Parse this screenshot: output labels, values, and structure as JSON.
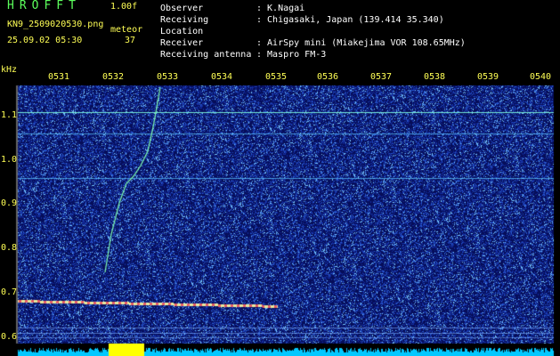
{
  "header": {
    "app_title": "HROFFT",
    "version": "1.00f",
    "filename": "KN9_2509020530.png",
    "mode": "meteor",
    "datetime": "25.09.02 05:30",
    "count": "37"
  },
  "info": [
    {
      "label": "Observer",
      "value": ": K.Nagai"
    },
    {
      "label": "Receiving Location",
      "value": ": Chigasaki, Japan (139.414 35.340)"
    },
    {
      "label": "Receiver",
      "value": ": AirSpy mini (Miakejima VOR 108.65MHz)"
    },
    {
      "label": "Receiving antenna",
      "value": ": Maspro FM-3"
    }
  ],
  "axis": {
    "freq_unit": "kHz",
    "time_ticks": [
      "0531",
      "0532",
      "0533",
      "0534",
      "0535",
      "0536",
      "0537",
      "0538",
      "0539",
      "0540"
    ],
    "freq_ticks": [
      "1.1",
      "1.0",
      "0.9",
      "0.8",
      "0.7",
      "0.6"
    ]
  },
  "colors": {
    "background": "#000000",
    "noise_base": "#0a1a8a",
    "signal": "#5cffd0",
    "text_yellow": "#ffff55",
    "title_green": "#5cff5c"
  }
}
